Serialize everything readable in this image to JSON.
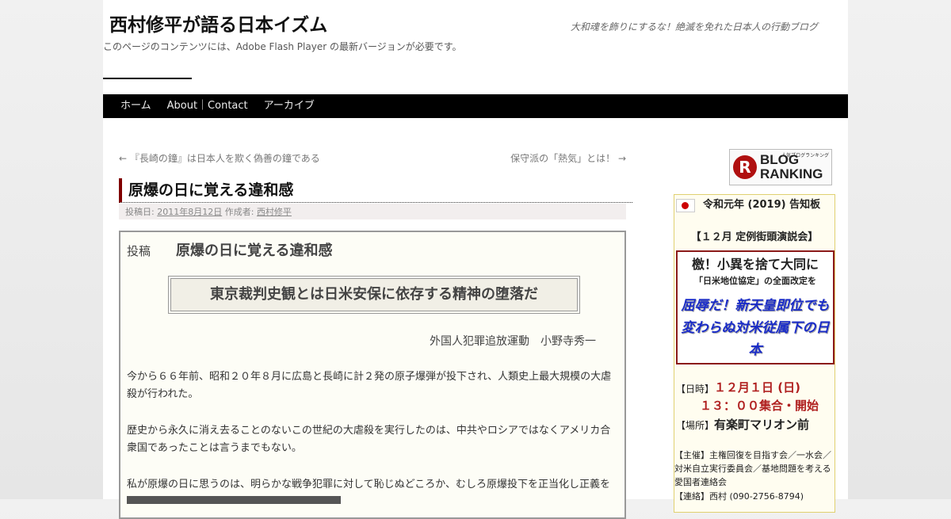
{
  "header": {
    "site_title": "西村修平が語る日本イズム",
    "site_description": "大和魂を飾りにするな！絶滅を免れた日本人の行動ブログ",
    "flash_notice": "このページのコンテンツには、Adobe Flash Player の最新バージョンが必要です。"
  },
  "menu": {
    "items": [
      "ホーム",
      "About｜Contact",
      "アーカイブ"
    ]
  },
  "post_nav": {
    "prev": "← 『長崎の鐘』は日本人を欺く偽善の鐘である",
    "next": "保守派の「熱気」とは！ →"
  },
  "entry": {
    "title": "原爆の日に覚える違和感",
    "meta_posted_label": "投稿日:",
    "meta_date": "2011年8月12日",
    "meta_author_label": "作成者:",
    "meta_author": "西村修平",
    "post_label": "投稿",
    "post_heading": "原爆の日に覚える違和感",
    "quote": "東京裁判史観とは日米安保に依存する精神の堕落だ",
    "author_line": "外国人犯罪追放運動　小野寺秀一",
    "paragraphs": [
      "今から６６年前、昭和２０年８月に広島と長崎に計２発の原子爆弾が投下され、人類史上最大規模の大虐殺が行われた。",
      "歴史から永久に消え去ることのないこの世紀の大虐殺を実行したのは、中共やロシアではなくアメリカ合衆国であったことは言うまでもない。",
      "私が原爆の日に思うのは、明らかな戦争犯罪に対して恥じぬどころか、むしろ原爆投下を正当化し正義を"
    ]
  },
  "sidebar": {
    "banner": {
      "main": "BLOG RANKING",
      "sub": "人気ブログランキング",
      "letter": "R"
    },
    "notice_title": "令和元年 (2019) 告知板",
    "event_title": "【１２月 定例街頭演説会】",
    "slogan_1": "檄！小異を捨て大同に",
    "slogan_2": "「日米地位協定」の全面改定を",
    "slogan_3": "屈辱だ！新天皇即位でも変わらぬ対米従属下の日本",
    "date_label": "【日時】",
    "date_value": "１２月１日 (日)",
    "time_value": "１３：００集合・開始",
    "place_label": "【場所】",
    "place_value": "有楽町マリオン前",
    "host": "【主催】主権回復を目指す会／一水会／対米自立実行委員会／基地問題を考える愛国者連絡会",
    "contact": "【連絡】西村 (090-2756-8794)"
  }
}
